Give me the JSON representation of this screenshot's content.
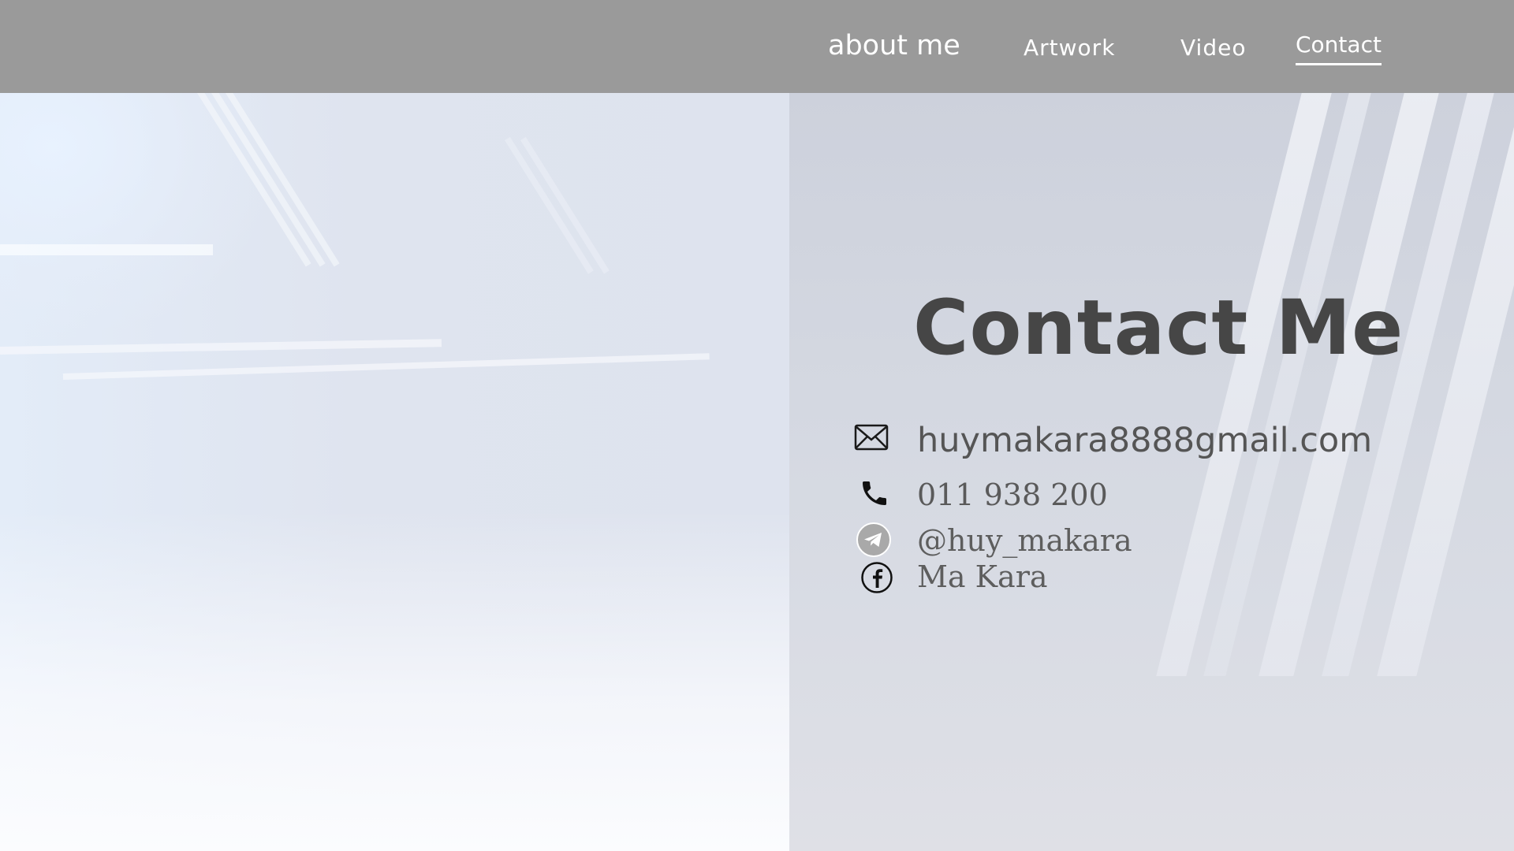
{
  "nav": {
    "items": [
      {
        "label": "about me"
      },
      {
        "label": "Artwork"
      },
      {
        "label": "Video"
      },
      {
        "label": "Contact",
        "active": true
      }
    ]
  },
  "contact": {
    "title": "Contact Me",
    "email": "huymakara8888gmail.com",
    "phone": "011 938 200",
    "telegram": "@huy_makara",
    "facebook": "Ma Kara"
  },
  "icons": {
    "email": "envelope-icon",
    "phone": "phone-icon",
    "telegram": "telegram-icon",
    "facebook": "facebook-icon"
  },
  "colors": {
    "navbar": "#9a9a9a",
    "nav_text": "#ffffff",
    "title": "#464646",
    "text": "#555555"
  }
}
